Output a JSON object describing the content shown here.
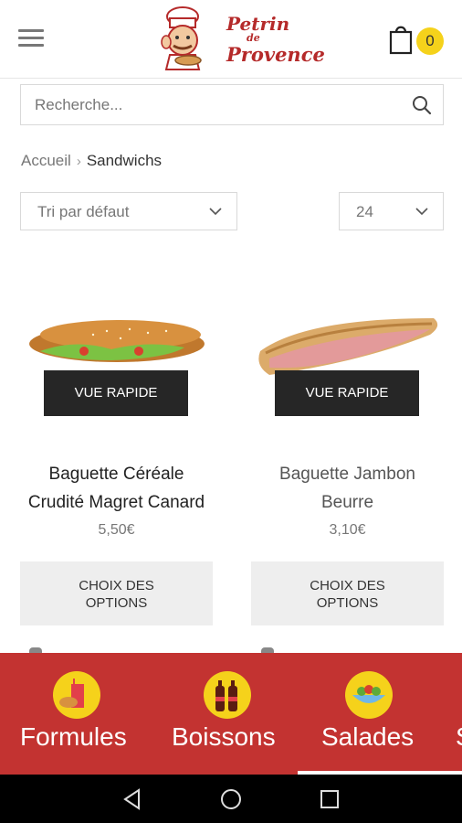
{
  "header": {
    "logo_line1": "Petrin",
    "logo_line2": "de",
    "logo_line3": "Provence",
    "cart_count": "0"
  },
  "search": {
    "placeholder": "Recherche..."
  },
  "breadcrumb": {
    "home": "Accueil",
    "current": "Sandwichs"
  },
  "sort": {
    "selected": "Tri par défaut"
  },
  "per_page": {
    "selected": "24"
  },
  "products": [
    {
      "name_line1": "Baguette Céréale",
      "name_line2": "Crudité Magret Canard",
      "price": "5,50€",
      "quick_view": "VUE RAPIDE",
      "options_line1": "CHOIX DES",
      "options_line2": "OPTIONS"
    },
    {
      "name_line1": "Baguette Jambon",
      "name_line2": "Beurre",
      "price": "3,10€",
      "quick_view": "VUE RAPIDE",
      "options_line1": "CHOIX DES",
      "options_line2": "OPTIONS"
    }
  ],
  "categories": [
    {
      "label": "Formules",
      "icon": "formules-icon"
    },
    {
      "label": "Boissons",
      "icon": "boissons-icon"
    },
    {
      "label": "Salades",
      "icon": "salades-icon"
    },
    {
      "label": "S",
      "icon": "next-category"
    }
  ],
  "colors": {
    "brand_red": "#c33331",
    "badge_yellow": "#f5d21b",
    "button_dark": "#262626"
  }
}
